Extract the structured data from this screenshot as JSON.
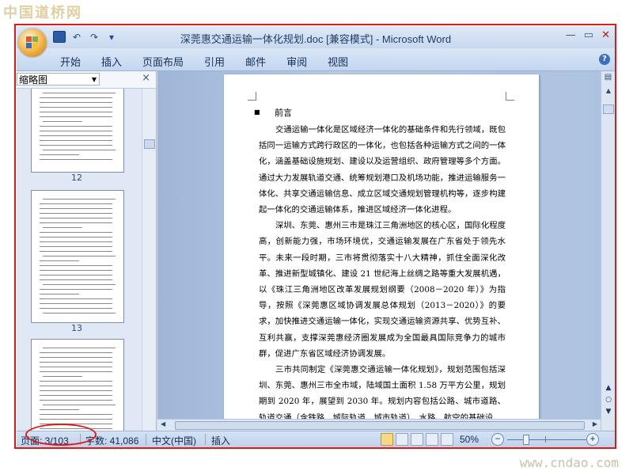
{
  "watermarks": {
    "top": "中国道桥网",
    "bottom": "www.cndao.com"
  },
  "window": {
    "title": "深莞惠交通运输一体化规划.doc [兼容模式] - Microsoft Word",
    "controls": {
      "minimize": "—",
      "maximize": "▭",
      "close": "✕"
    }
  },
  "quick_access": {
    "save": "save-icon",
    "undo": "↶",
    "redo": "↷",
    "customize": "▾"
  },
  "ribbon": {
    "tabs": [
      "开始",
      "插入",
      "页面布局",
      "引用",
      "邮件",
      "审阅",
      "视图"
    ],
    "help": "?"
  },
  "thumbnail_pane": {
    "dropdown": "缩略图",
    "close": "×",
    "pages": [
      "12",
      "13"
    ]
  },
  "document": {
    "heading": "前言",
    "paragraphs": [
      "交通运输一体化是区域经济一体化的基础条件和先行领域，既包括同一运输方式跨行政区的一体化，也包括各种运输方式之间的一体化，涵盖基础设施规划、建设以及运营组织、政府管理等多个方面。通过大力发展轨道交通、统筹规划港口及机场功能，推进运输服务一体化、共享交通运输信息、成立区域交通规划管理机构等，逐步构建起一体化的交通运输体系，推进区域经济一体化进程。",
      "深圳、东莞、惠州三市是珠江三角洲地区的核心区，国际化程度高，创新能力强，市场环境优，交通运输发展在广东省处于领先水平。未来一段时期，三市将贯彻落实十八大精神，抓住全面深化改革、推进新型城镇化、建设 21 世纪海上丝绸之路等重大发展机遇，以《珠江三角洲地区改革发展规划纲要（2008－2020 年）》为指导，按照《深莞惠区域协调发展总体规划（2013－2020）》的要求，加快推进交通运输一体化，实现交通运输资源共享、优势互补、互利共赢，支撑深莞惠经济圈发展成为全国最具国际竞争力的城市群，促进广东省区域经济协调发展。",
      "三市共同制定《深莞惠交通运输一体化规划》，规划范围包括深圳、东莞、惠州三市全市域，陆域国土面积 1.58 万平方公里，规划期到 2020 年，展望到 2030 年。规划内容包括公路、城市道路、轨道交通（含铁路、城际轨道、城市轨道）、水路、航空的基础设"
    ]
  },
  "status_bar": {
    "page": "页面: 3/103",
    "words": "字数: 41,086",
    "language": "中文(中国)",
    "mode": "插入",
    "zoom": "50%",
    "zoom_minus": "−",
    "zoom_plus": "+"
  },
  "scrollbar": {
    "ruler_icon": "ruler-icon",
    "up": "▲",
    "prev": "▲",
    "browse": "○",
    "next": "▼"
  },
  "colors": {
    "highlight": "#e01818",
    "window_blue": "#cfdcee"
  }
}
